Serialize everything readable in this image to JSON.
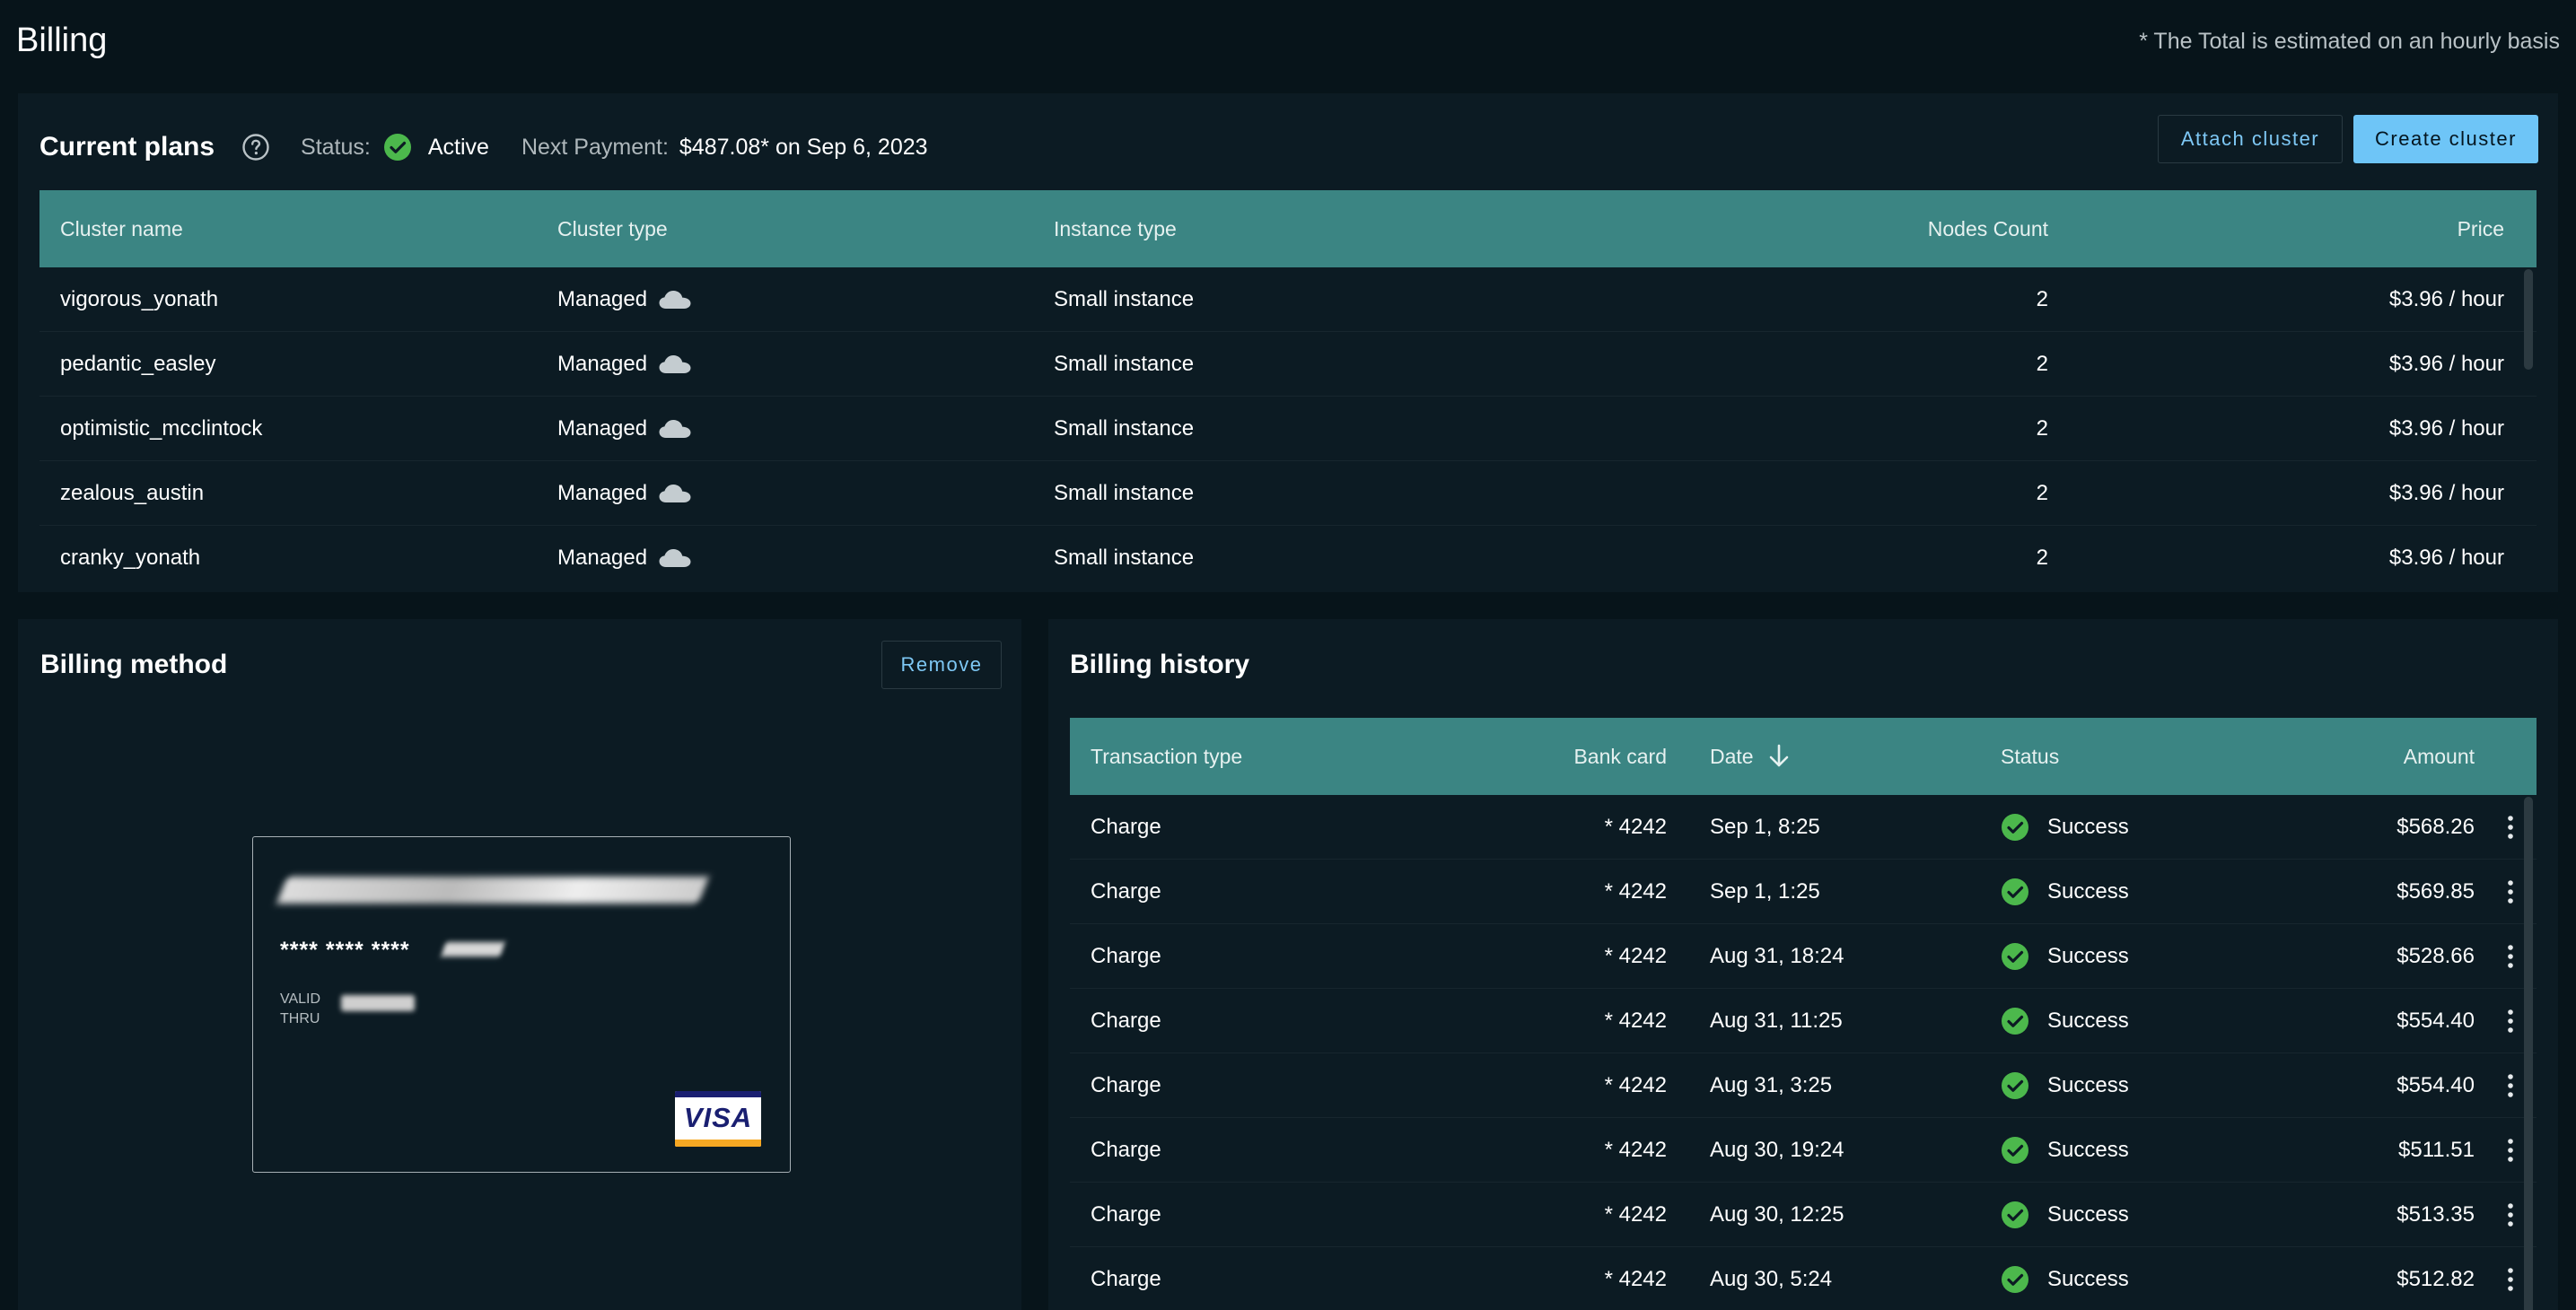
{
  "page": {
    "title": "Billing",
    "total_note": "* The Total is estimated on an hourly basis"
  },
  "plans": {
    "title": "Current plans",
    "status_label": "Status:",
    "status_value": "Active",
    "next_payment_label": "Next Payment:",
    "next_payment_value": "$487.08* on Sep 6, 2023",
    "attach_label": "Attach cluster",
    "create_label": "Create cluster",
    "columns": [
      "Cluster name",
      "Cluster type",
      "Instance type",
      "Nodes Count",
      "Price"
    ],
    "rows": [
      {
        "name": "vigorous_yonath",
        "type": "Managed",
        "instance": "Small instance",
        "nodes": "2",
        "price": "$3.96 / hour"
      },
      {
        "name": "pedantic_easley",
        "type": "Managed",
        "instance": "Small instance",
        "nodes": "2",
        "price": "$3.96 / hour"
      },
      {
        "name": "optimistic_mcclintock",
        "type": "Managed",
        "instance": "Small instance",
        "nodes": "2",
        "price": "$3.96 / hour"
      },
      {
        "name": "zealous_austin",
        "type": "Managed",
        "instance": "Small instance",
        "nodes": "2",
        "price": "$3.96 / hour"
      },
      {
        "name": "cranky_yonath",
        "type": "Managed",
        "instance": "Small instance",
        "nodes": "2",
        "price": "$3.96 / hour"
      }
    ]
  },
  "method": {
    "title": "Billing method",
    "remove_label": "Remove",
    "card_number": "**** **** ****",
    "valid_label_1": "VALID",
    "valid_label_2": "THRU",
    "brand": "VISA"
  },
  "history": {
    "title": "Billing history",
    "columns": [
      "Transaction type",
      "Bank card",
      "Date",
      "Status",
      "Amount"
    ],
    "rows": [
      {
        "type": "Charge",
        "card": "* 4242",
        "date": "Sep 1, 8:25",
        "status": "Success",
        "amount": "$568.26"
      },
      {
        "type": "Charge",
        "card": "* 4242",
        "date": "Sep 1, 1:25",
        "status": "Success",
        "amount": "$569.85"
      },
      {
        "type": "Charge",
        "card": "* 4242",
        "date": "Aug 31, 18:24",
        "status": "Success",
        "amount": "$528.66"
      },
      {
        "type": "Charge",
        "card": "* 4242",
        "date": "Aug 31, 11:25",
        "status": "Success",
        "amount": "$554.40"
      },
      {
        "type": "Charge",
        "card": "* 4242",
        "date": "Aug 31, 3:25",
        "status": "Success",
        "amount": "$554.40"
      },
      {
        "type": "Charge",
        "card": "* 4242",
        "date": "Aug 30, 19:24",
        "status": "Success",
        "amount": "$511.51"
      },
      {
        "type": "Charge",
        "card": "* 4242",
        "date": "Aug 30, 12:25",
        "status": "Success",
        "amount": "$513.35"
      },
      {
        "type": "Charge",
        "card": "* 4242",
        "date": "Aug 30, 5:24",
        "status": "Success",
        "amount": "$512.82"
      }
    ]
  },
  "colors": {
    "background": "#07141a",
    "panel": "#0c1b23",
    "table_header": "#3b8583",
    "accent": "#6ec5f7",
    "success": "#4cb84c"
  },
  "icons": {
    "help": "question-circle-icon",
    "status": "check-circle-icon",
    "cluster_type": "cloud-icon",
    "sort": "arrow-down-icon",
    "row_menu": "vertical-dots-icon"
  }
}
